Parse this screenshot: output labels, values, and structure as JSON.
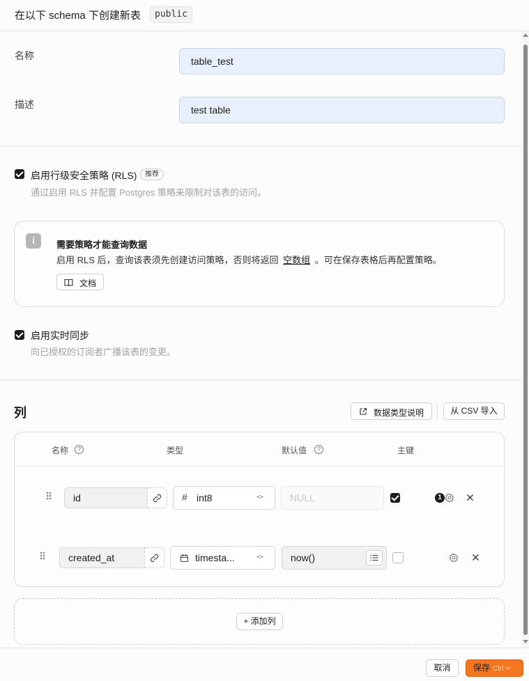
{
  "header": {
    "title": "在以下 schema 下创建新表",
    "schema": "public"
  },
  "form": {
    "name_label": "名称",
    "name_value": "table_test",
    "desc_label": "描述",
    "desc_value": "test table"
  },
  "rls": {
    "checked": true,
    "label": "启用行级安全策略 (RLS)",
    "badge": "推荐",
    "description": "通过启用 RLS 并配置 Postgres 策略来限制对该表的访问。"
  },
  "info_card": {
    "title": "需要策略才能查询数据",
    "text_before": "启用 RLS 后，查询该表须先创建访问策略，否则将返回",
    "link": "空数组",
    "text_after": "。可在保存表格后再配置策略。",
    "docs_button": "文档"
  },
  "realtime": {
    "checked": true,
    "label": "启用实时同步",
    "description": "向已授权的订阅者广播该表的变更。"
  },
  "columns_section": {
    "title": "列",
    "datatype_button": "数据类型说明",
    "import_button": "从 CSV 导入",
    "headers": {
      "name": "名称",
      "type": "类型",
      "default": "默认值",
      "primary": "主键"
    },
    "rows": [
      {
        "name": "id",
        "type_icon": "hash-icon",
        "type": "int8",
        "default_placeholder": "NULL",
        "primary": true,
        "badge": "1"
      },
      {
        "name": "created_at",
        "type_icon": "calendar-icon",
        "type": "timesta...",
        "default": "now()",
        "primary": false
      }
    ],
    "add_button": "+ 添加列"
  },
  "footer": {
    "cancel": "取消",
    "save": "保存",
    "shortcut": "Ctrl ↵"
  }
}
